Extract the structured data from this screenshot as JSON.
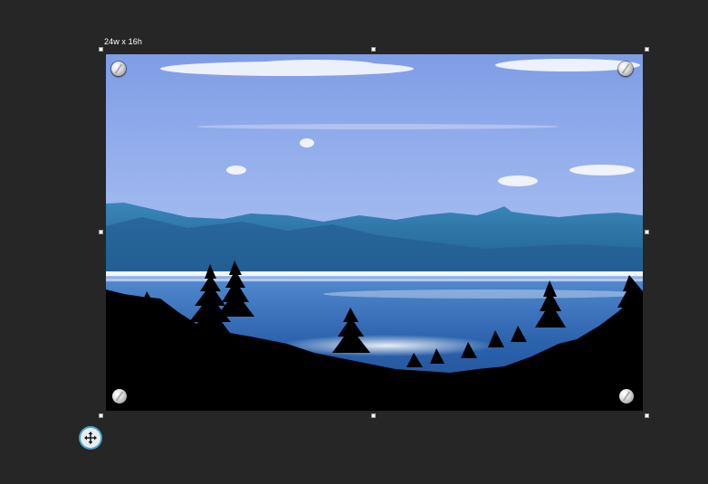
{
  "canvas": {
    "background": "#262626"
  },
  "selection": {
    "size_label": "24w x 16h"
  },
  "photo": {
    "subject": "lake-with-mountains-and-pine-silhouettes",
    "sky_color": "#8fa9ea",
    "water_color": "#2f6fb8",
    "mountain_color": "#2e6f9e"
  },
  "icons": {
    "move": "move-arrows-icon",
    "standoff": "standoff-screw-icon"
  },
  "colors": {
    "handle_fill": "#ffffff",
    "move_ring": "#4aa3c9"
  }
}
